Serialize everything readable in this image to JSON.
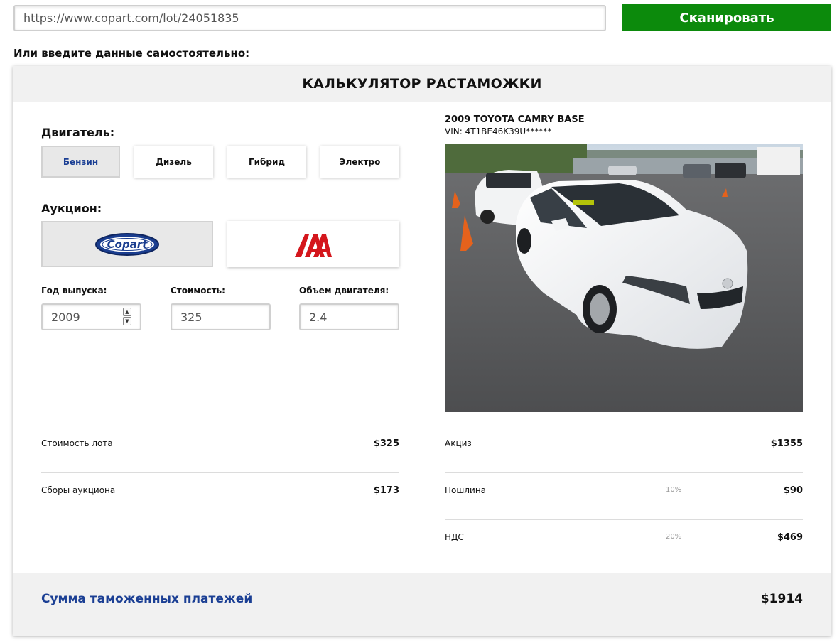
{
  "scan": {
    "url_value": "https://www.copart.com/lot/24051835",
    "button_label": "Сканировать"
  },
  "manual_label": "Или введите данные самостоятельно:",
  "calculator": {
    "title": "КАЛЬКУЛЯТОР РАСТАМОЖКИ",
    "engine": {
      "label": "Двигатель:",
      "options": [
        "Бензин",
        "Дизель",
        "Гибрид",
        "Электро"
      ],
      "selected": "Бензин"
    },
    "auction": {
      "label": "Аукцион:",
      "options": [
        {
          "name": "Copart",
          "logo_text": "Copart"
        },
        {
          "name": "IAA",
          "logo_text": "IAA"
        }
      ],
      "selected": "Copart"
    },
    "fields": {
      "year": {
        "label": "Год выпуска:",
        "value": "2009"
      },
      "price": {
        "label": "Стоимость:",
        "value": "325"
      },
      "volume": {
        "label": "Объем двигателя:",
        "value": "2.4"
      }
    },
    "vehicle": {
      "title": "2009 TOYOTA CAMRY BASE",
      "vin": "VIN: 4T1BE46K39U******"
    },
    "left_costs": [
      {
        "label": "Стоимость лота",
        "value": "$325"
      },
      {
        "label": "Сборы аукциона",
        "value": "$173"
      }
    ],
    "right_costs": [
      {
        "label": "Акциз",
        "pct": "",
        "value": "$1355"
      },
      {
        "label": "Пошлина",
        "pct": "10%",
        "value": "$90"
      },
      {
        "label": "НДС",
        "pct": "20%",
        "value": "$469"
      }
    ],
    "total": {
      "label": "Сумма таможенных платежей",
      "value": "$1914"
    }
  },
  "colors": {
    "scan_button": "#0c8a0c",
    "accent_blue": "#1b3f94",
    "iaa_red": "#d4161c"
  }
}
